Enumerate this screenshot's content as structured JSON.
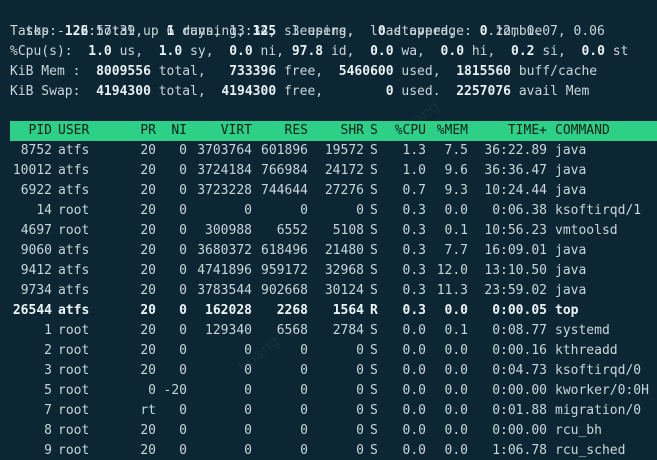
{
  "summary": {
    "uptime_line": "top - 22:57:39 up 6 days, 13:34,  3 users,  load average: 0.12, 0.07, 0.06",
    "tasks": {
      "label": "Tasks:",
      "total": "126",
      "total_label": "total,",
      "running": "1",
      "running_label": "running,",
      "sleeping": "125",
      "sleeping_label": "sleeping,",
      "stopped": "0",
      "stopped_label": "stopped,",
      "zombie": "0",
      "zombie_label": "zombie"
    },
    "cpu": {
      "label": "%Cpu(s):",
      "us": "1.0",
      "us_label": "us,",
      "sy": "1.0",
      "sy_label": "sy,",
      "ni": "0.0",
      "ni_label": "ni,",
      "id": "97.8",
      "id_label": "id,",
      "wa": "0.0",
      "wa_label": "wa,",
      "hi": "0.0",
      "hi_label": "hi,",
      "si": "0.2",
      "si_label": "si,",
      "st": "0.0",
      "st_label": "st"
    },
    "mem": {
      "label": "KiB Mem :",
      "total": "8009556",
      "total_label": "total,",
      "free": "733396",
      "free_label": "free,",
      "used": "5460600",
      "used_label": "used,",
      "buff": "1815560",
      "buff_label": "buff/cache"
    },
    "swap": {
      "label": "KiB Swap:",
      "total": "4194300",
      "total_label": "total,",
      "free": "4194300",
      "free_label": "free,",
      "used": "0",
      "used_label": "used.",
      "avail": "2257076",
      "avail_label": "avail Mem"
    }
  },
  "table": {
    "columns": [
      "PID",
      "USER",
      "PR",
      "NI",
      "VIRT",
      "RES",
      "SHR",
      "S",
      "%CPU",
      "%MEM",
      "TIME+",
      "COMMAND"
    ],
    "rows": [
      {
        "pid": "8752",
        "user": "atfs",
        "pr": "20",
        "ni": "0",
        "virt": "3703764",
        "res": "601896",
        "shr": "19572",
        "s": "S",
        "cpu": "1.3",
        "mem": "7.5",
        "time": "36:22.89",
        "cmd": "java",
        "bold": false
      },
      {
        "pid": "10012",
        "user": "atfs",
        "pr": "20",
        "ni": "0",
        "virt": "3724184",
        "res": "766984",
        "shr": "24172",
        "s": "S",
        "cpu": "1.0",
        "mem": "9.6",
        "time": "36:36.47",
        "cmd": "java",
        "bold": false
      },
      {
        "pid": "6922",
        "user": "atfs",
        "pr": "20",
        "ni": "0",
        "virt": "3723228",
        "res": "744644",
        "shr": "27276",
        "s": "S",
        "cpu": "0.7",
        "mem": "9.3",
        "time": "10:24.44",
        "cmd": "java",
        "bold": false
      },
      {
        "pid": "14",
        "user": "root",
        "pr": "20",
        "ni": "0",
        "virt": "0",
        "res": "0",
        "shr": "0",
        "s": "S",
        "cpu": "0.3",
        "mem": "0.0",
        "time": "0:06.38",
        "cmd": "ksoftirqd/1",
        "bold": false
      },
      {
        "pid": "4697",
        "user": "root",
        "pr": "20",
        "ni": "0",
        "virt": "300988",
        "res": "6552",
        "shr": "5108",
        "s": "S",
        "cpu": "0.3",
        "mem": "0.1",
        "time": "10:56.23",
        "cmd": "vmtoolsd",
        "bold": false
      },
      {
        "pid": "9060",
        "user": "atfs",
        "pr": "20",
        "ni": "0",
        "virt": "3680372",
        "res": "618496",
        "shr": "21480",
        "s": "S",
        "cpu": "0.3",
        "mem": "7.7",
        "time": "16:09.01",
        "cmd": "java",
        "bold": false
      },
      {
        "pid": "9412",
        "user": "atfs",
        "pr": "20",
        "ni": "0",
        "virt": "4741896",
        "res": "959172",
        "shr": "32968",
        "s": "S",
        "cpu": "0.3",
        "mem": "12.0",
        "time": "13:10.50",
        "cmd": "java",
        "bold": false
      },
      {
        "pid": "9734",
        "user": "atfs",
        "pr": "20",
        "ni": "0",
        "virt": "3783544",
        "res": "902668",
        "shr": "30124",
        "s": "S",
        "cpu": "0.3",
        "mem": "11.3",
        "time": "23:59.02",
        "cmd": "java",
        "bold": false
      },
      {
        "pid": "26544",
        "user": "atfs",
        "pr": "20",
        "ni": "0",
        "virt": "162028",
        "res": "2268",
        "shr": "1564",
        "s": "R",
        "cpu": "0.3",
        "mem": "0.0",
        "time": "0:00.05",
        "cmd": "top",
        "bold": true
      },
      {
        "pid": "1",
        "user": "root",
        "pr": "20",
        "ni": "0",
        "virt": "129340",
        "res": "6568",
        "shr": "2784",
        "s": "S",
        "cpu": "0.0",
        "mem": "0.1",
        "time": "0:08.77",
        "cmd": "systemd",
        "bold": false
      },
      {
        "pid": "2",
        "user": "root",
        "pr": "20",
        "ni": "0",
        "virt": "0",
        "res": "0",
        "shr": "0",
        "s": "S",
        "cpu": "0.0",
        "mem": "0.0",
        "time": "0:00.16",
        "cmd": "kthreadd",
        "bold": false
      },
      {
        "pid": "3",
        "user": "root",
        "pr": "20",
        "ni": "0",
        "virt": "0",
        "res": "0",
        "shr": "0",
        "s": "S",
        "cpu": "0.0",
        "mem": "0.0",
        "time": "0:04.73",
        "cmd": "ksoftirqd/0",
        "bold": false
      },
      {
        "pid": "5",
        "user": "root",
        "pr": "0",
        "ni": "-20",
        "virt": "0",
        "res": "0",
        "shr": "0",
        "s": "S",
        "cpu": "0.0",
        "mem": "0.0",
        "time": "0:00.00",
        "cmd": "kworker/0:0H",
        "bold": false
      },
      {
        "pid": "7",
        "user": "root",
        "pr": "rt",
        "ni": "0",
        "virt": "0",
        "res": "0",
        "shr": "0",
        "s": "S",
        "cpu": "0.0",
        "mem": "0.0",
        "time": "0:01.88",
        "cmd": "migration/0",
        "bold": false
      },
      {
        "pid": "8",
        "user": "root",
        "pr": "20",
        "ni": "0",
        "virt": "0",
        "res": "0",
        "shr": "0",
        "s": "S",
        "cpu": "0.0",
        "mem": "0.0",
        "time": "0:00.00",
        "cmd": "rcu_bh",
        "bold": false
      },
      {
        "pid": "9",
        "user": "root",
        "pr": "20",
        "ni": "0",
        "virt": "0",
        "res": "0",
        "shr": "0",
        "s": "S",
        "cpu": "0.0",
        "mem": "0.0",
        "time": "1:06.78",
        "cmd": "rcu_sched",
        "bold": false
      }
    ]
  },
  "colors": {
    "background": "#0c2633",
    "header_bar": "#2ecf86",
    "text": "#c9d6dc"
  }
}
